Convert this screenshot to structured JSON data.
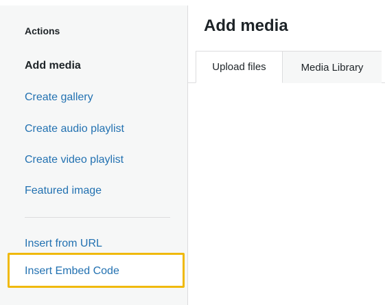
{
  "sidebar": {
    "heading": "Actions",
    "items": [
      {
        "label": "Add media"
      },
      {
        "label": "Create gallery"
      },
      {
        "label": "Create audio playlist"
      },
      {
        "label": "Create video playlist"
      },
      {
        "label": "Featured image"
      },
      {
        "label": "Insert from URL"
      },
      {
        "label": "Insert Embed Code"
      }
    ]
  },
  "main": {
    "title": "Add media",
    "tabs": [
      {
        "label": "Upload files"
      },
      {
        "label": "Media Library"
      }
    ]
  },
  "colors": {
    "link": "#2271b1",
    "text": "#1d2327",
    "sidebar_bg": "#f6f7f7",
    "highlight": "#f0b90b"
  }
}
